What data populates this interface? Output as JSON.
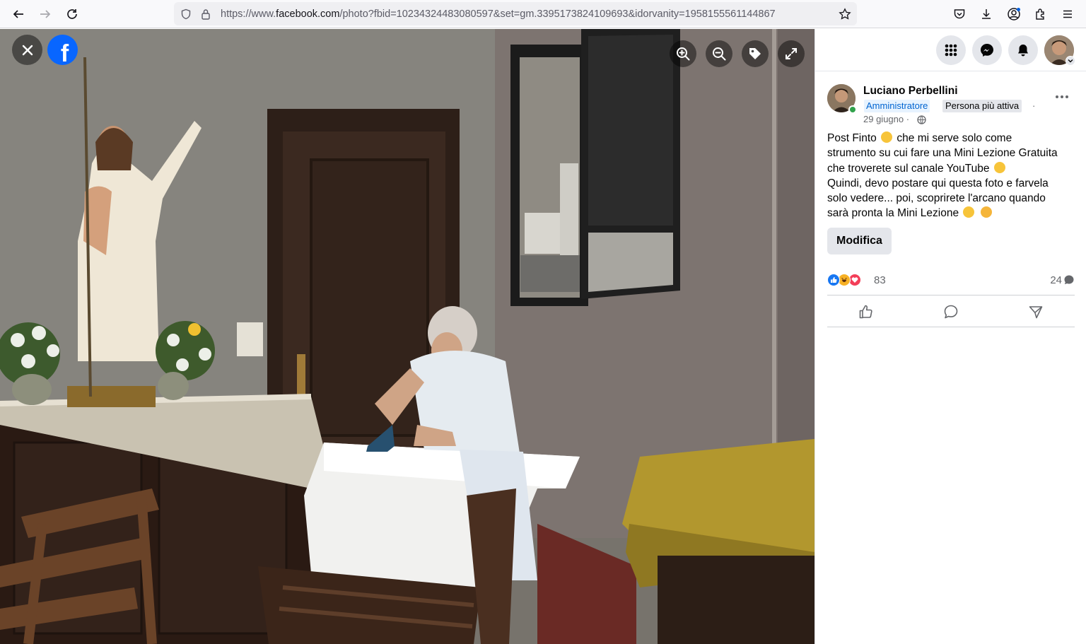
{
  "browser": {
    "url_prefix": "https://www.",
    "url_domain": "facebook.com",
    "url_path": "/photo?fbid=10234324483080597&set=gm.3395173824109693&idorvanity=1958155561144867"
  },
  "viewer": {
    "logo_letter": "f"
  },
  "post": {
    "author": "Luciano Perbellini",
    "badge_admin": "Amministratore",
    "badge_active": "Persona più attiva",
    "badge_sep": "·",
    "date": "29 giugno ·",
    "lines": [
      "Post Finto",
      "che mi serve solo come",
      "strumento su cui fare una Mini Lezione Gratuita",
      "che troverete sul canale YouTube",
      "Quindi, devo postare qui questa foto e farvela",
      "solo vedere... poi, scoprirete l'arcano quando",
      "sarà pronta la Mini Lezione"
    ],
    "edit_label": "Modifica",
    "reaction_count": "83",
    "comment_count": "24"
  },
  "colors": {
    "accent": "#0866ff",
    "like": "#1877f2",
    "love": "#f33e58",
    "haha": "#f7b125",
    "online": "#31a24c"
  }
}
